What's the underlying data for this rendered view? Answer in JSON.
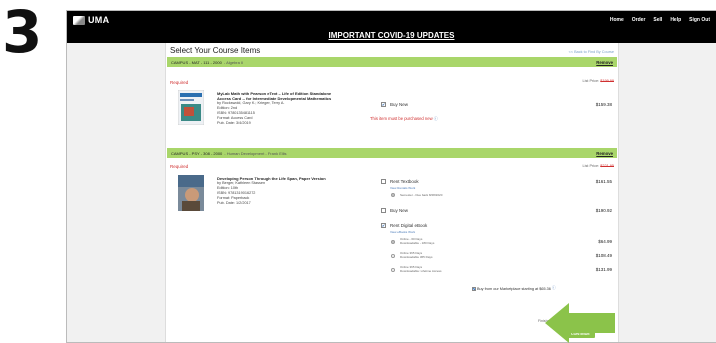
{
  "step_number": "3",
  "app": {
    "name": "UMA"
  },
  "nav": [
    "Home",
    "Order",
    "Sell",
    "Help",
    "Sign Out"
  ],
  "banner": "IMPORTANT COVID-19 UPDATES",
  "page": {
    "title": "Select Your Course Items",
    "back_link": "<< Back to Find By Course"
  },
  "courses": [
    {
      "bar": "CAMPUS - MAT - 111 - 2000",
      "bar_sub": "- Algebra II",
      "remove": "Remove",
      "required": "Required",
      "list_price": "List Price:",
      "list_price_value": "$199.99",
      "title": "MyLab Math with Pearson eText – Life of Edition Standalone Access Card -- for Intermediate Developmental Mathematics",
      "authors": "by Rockswold, Gary K.; Krieger, Terry A.",
      "edition": "Edition: 2nd",
      "isbn": "ISBN: 9780135481115",
      "format": "Format: Access Card",
      "pub_date": "Pub. Date: 3/4/2019",
      "buy_new": "Buy New",
      "buy_new_price": "$159.38",
      "warning": "This item must be purchased new"
    },
    {
      "bar": "CAMPUS - PSY - 308 - 2000",
      "bar_sub": "- Human Development - Frank Ellis",
      "remove": "Remove",
      "required": "Required",
      "list_price": "List Price:",
      "list_price_value": "$221.95",
      "title": "Developing Person Through the Life Span, Paper Version",
      "authors": "by Berger, Kathleen Stassen",
      "edition": "Edition: 10th",
      "isbn": "ISBN: 9781319016272",
      "format": "Format: Paperback",
      "pub_date": "Pub. Date: 1/2/2017",
      "rent_textbook": "Rent Textbook",
      "rent_textbook_price": "$161.55",
      "rent_textbook_link": "View Rentals Work",
      "semester": "Semester - Due back 8/28/2020",
      "buy_new": "Buy New",
      "buy_new_price": "$190.92",
      "rent_digital": "Rent Digital eBook",
      "rent_digital_link": "View eBooks Work",
      "ebook_options": [
        {
          "line1": "Online - 60 Days",
          "line2": "Downloadable - 180 Days",
          "price": "$64.99",
          "selected": true
        },
        {
          "line1": "Online 365 Days",
          "line2": "Downloadable 365 Days",
          "price": "$108.49",
          "selected": false
        },
        {
          "line1": "Online 365 Days",
          "line2": "Downloadable: Lifetime Access",
          "price": "$131.99",
          "selected": false
        }
      ],
      "marketplace": "Buy from our Marketplace starting at $65.36"
    }
  ],
  "finish_question": "Finished selecting items?",
  "continue_label": "CONTINUE",
  "colors": {
    "green_bar": "#a9d66a",
    "arrow": "#8bc34a",
    "required": "#d03030"
  }
}
